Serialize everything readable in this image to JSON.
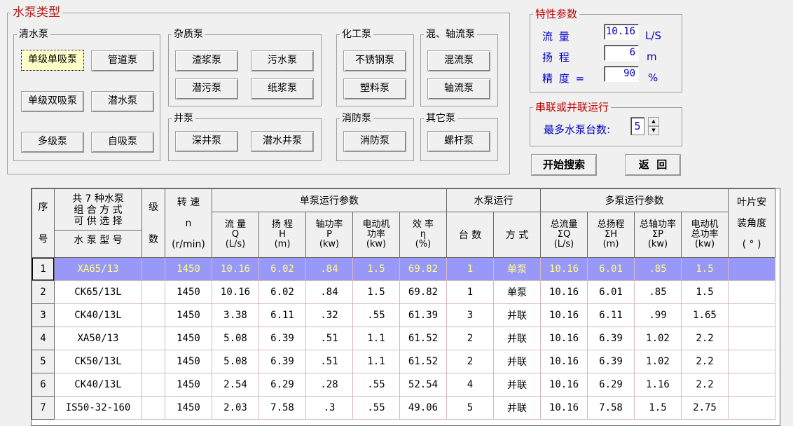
{
  "groups": {
    "main": "水泵类型",
    "clear": "清水泵",
    "impurity": "杂质泵",
    "chemical": "化工泵",
    "mixed": "混、轴流泵",
    "well": "井泵",
    "fire": "消防泵",
    "other": "其它泵"
  },
  "buttons": {
    "single_stage_single_suction": "单级单吸泵",
    "pipeline": "管道泵",
    "single_stage_double_suction": "单级双吸泵",
    "submersible": "潜水泵",
    "multistage": "多级泵",
    "self_priming": "自吸泵",
    "slurry": "渣浆泵",
    "sewage": "污水泵",
    "submersible_sewage": "潜污泵",
    "paper_pulp": "纸浆泵",
    "stainless": "不锈钢泵",
    "plastic": "塑料泵",
    "mixed_flow": "混流泵",
    "axial_flow": "轴流泵",
    "deep_well": "深井泵",
    "submersible_well": "潜水井泵",
    "fire": "消防泵",
    "screw": "螺杆泵"
  },
  "params": {
    "title": "特性参数",
    "flow_label": "流  量",
    "flow_value": "10.16",
    "flow_unit": "L/S",
    "head_label": "扬  程",
    "head_value": "6",
    "head_unit": "m",
    "accuracy_label": "精  度 =",
    "accuracy_value": "90",
    "accuracy_unit": "%"
  },
  "series": {
    "title": "串联或并联运行",
    "max_label": "最多水泵台数:",
    "max_value": "5"
  },
  "actions": {
    "search": "开始搜索",
    "back": "返  回"
  },
  "table": {
    "h_seq_1": "序",
    "h_seq_2": "号",
    "h_combo_1": "共 7 种水泵",
    "h_combo_2": "组 合 方 式",
    "h_combo_3": "可 供 选 择",
    "h_model": "水 泵 型 号",
    "h_stage_1": "级",
    "h_stage_2": "数",
    "h_speed_1": "转  速",
    "h_speed_2": "n",
    "h_speed_3": "(r/min)",
    "h_single": "单泵运行参数",
    "h_flow_1": "流  量",
    "h_flow_2": "Q",
    "h_flow_3": "(L/s)",
    "h_head_1": "扬  程",
    "h_head_2": "H",
    "h_head_3": "(m)",
    "h_shaft_1": "轴功率",
    "h_shaft_2": "P",
    "h_shaft_3": "(kw)",
    "h_motor_1": "电动机",
    "h_motor_2": "功率",
    "h_motor_3": "(kw)",
    "h_eff_1": "效  率",
    "h_eff_2": "η",
    "h_eff_3": "(%)",
    "h_pumprun": "水泵运行",
    "h_count": "台  数",
    "h_mode": "方  式",
    "h_multi": "多泵运行参数",
    "h_tflow_1": "总流量",
    "h_tflow_2": "ΣQ",
    "h_tflow_3": "(L/s)",
    "h_thead_1": "总扬程",
    "h_thead_2": "ΣH",
    "h_thead_3": "(m)",
    "h_tshaft_1": "总轴功率",
    "h_tshaft_2": "ΣP",
    "h_tshaft_3": "(kw)",
    "h_tmotor_1": "电动机",
    "h_tmotor_2": "总功率",
    "h_tmotor_3": "(kw)",
    "h_blade_1": "叶片安",
    "h_blade_2": "装角度",
    "h_blade_3": "( ° )",
    "rows": [
      {
        "idx": "1",
        "model": "XA65/13",
        "stage": "",
        "speed": "1450",
        "q": "10.16",
        "h": "6.02",
        "p": ".84",
        "motor": "1.5",
        "eff": "69.82",
        "count": "1",
        "mode": "单泵",
        "tq": "10.16",
        "th": "6.01",
        "tp": ".85",
        "tmotor": "1.5",
        "blade": ""
      },
      {
        "idx": "2",
        "model": "CK65/13L",
        "stage": "",
        "speed": "1450",
        "q": "10.16",
        "h": "6.02",
        "p": ".84",
        "motor": "1.5",
        "eff": "69.82",
        "count": "1",
        "mode": "单泵",
        "tq": "10.16",
        "th": "6.01",
        "tp": ".85",
        "tmotor": "1.5",
        "blade": ""
      },
      {
        "idx": "3",
        "model": "CK40/13L",
        "stage": "",
        "speed": "1450",
        "q": "3.38",
        "h": "6.11",
        "p": ".32",
        "motor": ".55",
        "eff": "61.39",
        "count": "3",
        "mode": "并联",
        "tq": "10.16",
        "th": "6.11",
        "tp": ".99",
        "tmotor": "1.65",
        "blade": ""
      },
      {
        "idx": "4",
        "model": "XA50/13",
        "stage": "",
        "speed": "1450",
        "q": "5.08",
        "h": "6.39",
        "p": ".51",
        "motor": "1.1",
        "eff": "61.52",
        "count": "2",
        "mode": "并联",
        "tq": "10.16",
        "th": "6.39",
        "tp": "1.02",
        "tmotor": "2.2",
        "blade": ""
      },
      {
        "idx": "5",
        "model": "CK50/13L",
        "stage": "",
        "speed": "1450",
        "q": "5.08",
        "h": "6.39",
        "p": ".51",
        "motor": "1.1",
        "eff": "61.52",
        "count": "2",
        "mode": "并联",
        "tq": "10.16",
        "th": "6.39",
        "tp": "1.02",
        "tmotor": "2.2",
        "blade": ""
      },
      {
        "idx": "6",
        "model": "CK40/13L",
        "stage": "",
        "speed": "1450",
        "q": "2.54",
        "h": "6.29",
        "p": ".28",
        "motor": ".55",
        "eff": "52.54",
        "count": "4",
        "mode": "并联",
        "tq": "10.16",
        "th": "6.29",
        "tp": "1.16",
        "tmotor": "2.2",
        "blade": ""
      },
      {
        "idx": "7",
        "model": "IS50-32-160",
        "stage": "",
        "speed": "1450",
        "q": "2.03",
        "h": "7.58",
        "p": ".3",
        "motor": ".55",
        "eff": "49.06",
        "count": "5",
        "mode": "并联",
        "tq": "10.16",
        "th": "7.58",
        "tp": "1.5",
        "tmotor": "2.75",
        "blade": ""
      }
    ]
  }
}
